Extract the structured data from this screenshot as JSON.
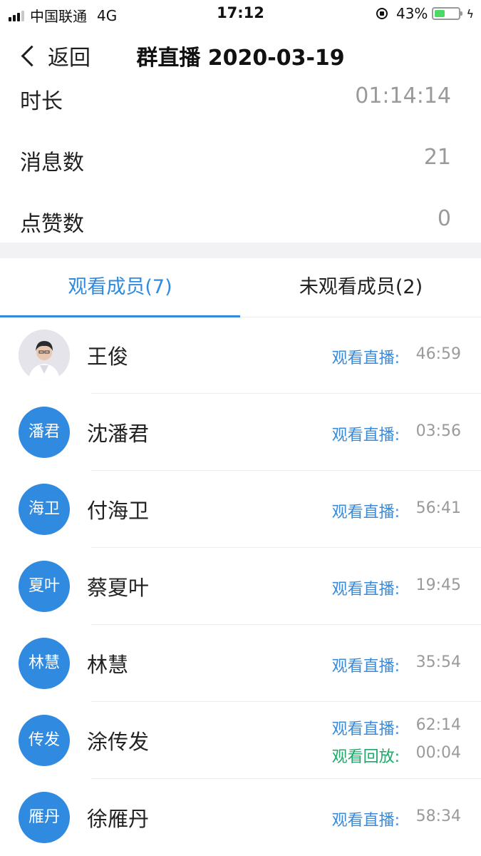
{
  "status_bar": {
    "carrier": "中国联通",
    "network": "4G",
    "time": "17:12",
    "battery": "43%",
    "battery_level": 0.43
  },
  "nav": {
    "back_label": "返回",
    "title": "群直播 2020-03-19"
  },
  "stats": [
    {
      "label": "时长",
      "value": "01:14:14"
    },
    {
      "label": "消息数",
      "value": "21"
    },
    {
      "label": "点赞数",
      "value": "0"
    }
  ],
  "tabs": {
    "watched": "观看成员(7)",
    "not_watched": "未观看成员(2)"
  },
  "members": [
    {
      "avatar": "",
      "name": "王俊",
      "live_label": "观看直播:",
      "live_time": "46:59"
    },
    {
      "avatar": "潘君",
      "name": "沈潘君",
      "live_label": "观看直播:",
      "live_time": "03:56"
    },
    {
      "avatar": "海卫",
      "name": "付海卫",
      "live_label": "观看直播:",
      "live_time": "56:41"
    },
    {
      "avatar": "夏叶",
      "name": "蔡夏叶",
      "live_label": "观看直播:",
      "live_time": "19:45"
    },
    {
      "avatar": "林慧",
      "name": "林慧",
      "live_label": "观看直播:",
      "live_time": "35:54"
    },
    {
      "avatar": "传发",
      "name": "涂传发",
      "live_label": "观看直播:",
      "live_time": "62:14",
      "replay_label": "观看回放:",
      "replay_time": "00:04"
    },
    {
      "avatar": "雁丹",
      "name": "徐雁丹",
      "live_label": "观看直播:",
      "live_time": "58:34"
    }
  ],
  "colors": {
    "accent": "#2f8ae0",
    "replay": "#1fa86a",
    "muted": "#9a9a9a",
    "battery": "#4cd964"
  }
}
